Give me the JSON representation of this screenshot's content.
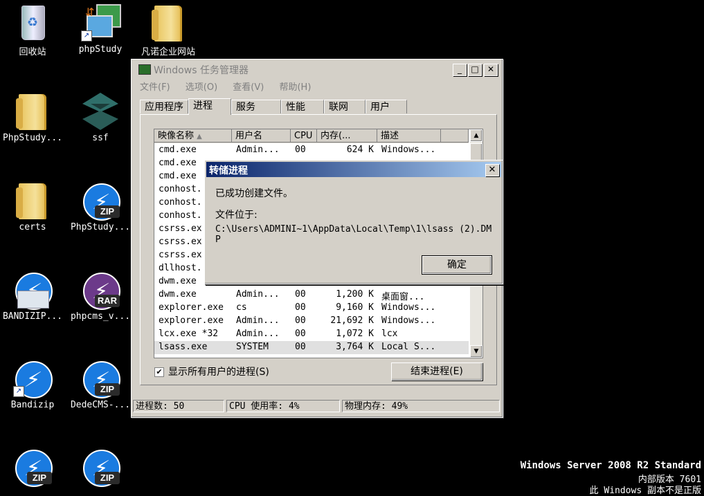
{
  "desktop_icons": [
    {
      "label": "回收站",
      "icon": "recycle-bin-icon"
    },
    {
      "label": "phpStudy",
      "icon": "phpstudy-icon"
    },
    {
      "label": "凡诺企业网站",
      "icon": "folder-icon"
    },
    {
      "label": "PhpStudy...",
      "icon": "folder-icon"
    },
    {
      "label": "ssf",
      "icon": "ssf-app-icon"
    },
    {
      "label": "certs",
      "icon": "folder-icon"
    },
    {
      "label": "PhpStudy...",
      "icon": "zip-archive-icon",
      "badge": "ZIP"
    },
    {
      "label": "BANDIZIP...",
      "icon": "bandizip-setup-icon"
    },
    {
      "label": "phpcms_v...",
      "icon": "rar-archive-icon",
      "badge": "RAR"
    },
    {
      "label": "Bandizip",
      "icon": "bandizip-icon"
    },
    {
      "label": "DedeCMS-...",
      "icon": "zip-archive-icon",
      "badge": "ZIP"
    },
    {
      "label": "",
      "icon": "zip-archive-icon",
      "badge": "ZIP"
    },
    {
      "label": "",
      "icon": "zip-archive-icon",
      "badge": "ZIP"
    }
  ],
  "watermark": {
    "line1": "Windows Server 2008 R2 Standard",
    "line2": "内部版本 7601",
    "line3": "此 Windows 副本不是正版"
  },
  "taskmgr": {
    "title": "Windows 任务管理器",
    "menu": [
      "文件(F)",
      "选项(O)",
      "查看(V)",
      "帮助(H)"
    ],
    "tabs": [
      "应用程序",
      "进程",
      "服务",
      "性能",
      "联网",
      "用户"
    ],
    "active_tab": "进程",
    "columns": [
      "映像名称",
      "用户名",
      "CPU",
      "内存(...",
      "描述"
    ],
    "rows": [
      [
        "cmd.exe",
        "Admin...",
        "00",
        "624 K",
        "Windows..."
      ],
      [
        "cmd.exe",
        "",
        "",
        "",
        ""
      ],
      [
        "cmd.exe",
        "",
        "",
        "",
        ""
      ],
      [
        "conhost.",
        "",
        "",
        "",
        ""
      ],
      [
        "conhost.",
        "",
        "",
        "",
        ""
      ],
      [
        "conhost.",
        "",
        "",
        "",
        ""
      ],
      [
        "csrss.ex",
        "",
        "",
        "",
        ""
      ],
      [
        "csrss.ex",
        "",
        "",
        "",
        ""
      ],
      [
        "csrss.ex",
        "",
        "",
        "",
        ""
      ],
      [
        "dllhost.",
        "",
        "",
        "",
        ""
      ],
      [
        "dwm.exe",
        "",
        "",
        "",
        ""
      ],
      [
        "dwm.exe",
        "Admin...",
        "00",
        "1,200 K",
        "桌面窗..."
      ],
      [
        "explorer.exe",
        "cs",
        "00",
        "9,160 K",
        "Windows..."
      ],
      [
        "explorer.exe",
        "Admin...",
        "00",
        "21,692 K",
        "Windows..."
      ],
      [
        "lcx.exe *32",
        "Admin...",
        "00",
        "1,072 K",
        "lcx"
      ],
      [
        "lsass.exe",
        "SYSTEM",
        "00",
        "3,764 K",
        "Local S..."
      ]
    ],
    "show_all_label": "显示所有用户的进程(S)",
    "end_process_label": "结束进程(E)",
    "status": {
      "processes": "进程数: 50",
      "cpu": "CPU 使用率: 4%",
      "memory": "物理内存: 49%"
    }
  },
  "dialog": {
    "title": "转储进程",
    "message": "已成功创建文件。",
    "location_label": "文件位于:",
    "path": "C:\\Users\\ADMINI~1\\AppData\\Local\\Temp\\1\\lsass (2).DMP",
    "ok_label": "确定"
  }
}
